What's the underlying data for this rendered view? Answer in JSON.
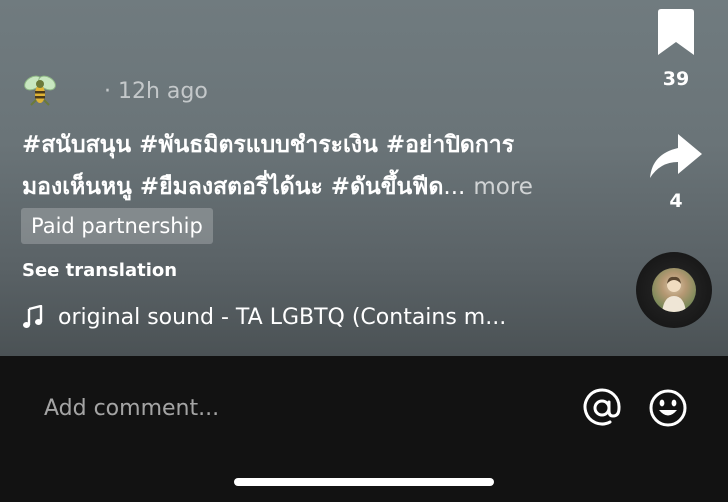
{
  "post": {
    "time": "· 12h ago",
    "caption_line1": "#สนับสนุน #พันธมิตรแบบชำระเงิน #อย่าปิดการ",
    "caption_line2": "มองเห็นหนู #ยืมลงสตอรี่ได้นะ #ดันขึ้นฟีด",
    "caption_ellipsis": "...",
    "more_label": "more",
    "paid_badge": "Paid partnership",
    "see_translation": "See translation",
    "sound": "original sound - TA LGBTQ (Contains m..."
  },
  "rail": {
    "bookmark_count": "39",
    "share_count": "4"
  },
  "comment": {
    "placeholder": "Add comment..."
  },
  "icons": {
    "bookmark": "bookmark-icon",
    "share": "share-icon",
    "music": "music-note-icon",
    "at": "at-mention-icon",
    "emoji": "emoji-icon",
    "avatar": "bee-avatar-icon"
  }
}
